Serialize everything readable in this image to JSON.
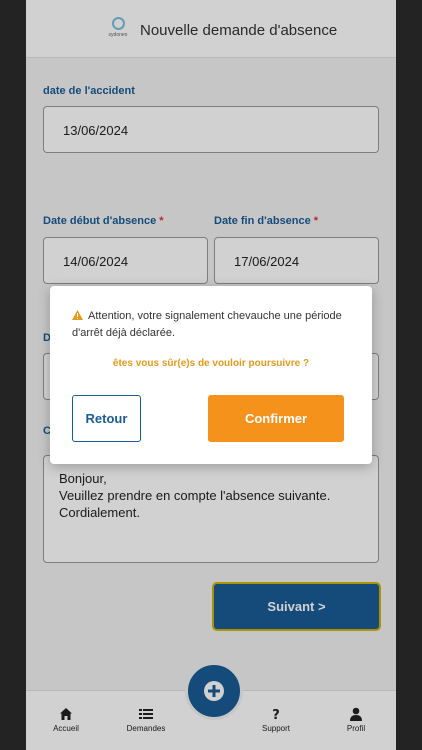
{
  "header": {
    "logo_text": "sydoneo",
    "title": "Nouvelle demande d'absence"
  },
  "form": {
    "accident_date": {
      "label": "date de l'accident",
      "value": "13/06/2024"
    },
    "start_date": {
      "label": "Date début d'absence",
      "required_mark": "*",
      "value": "14/06/2024"
    },
    "end_date": {
      "label": "Date fin d'absence",
      "required_mark": "*",
      "value": "17/06/2024"
    },
    "hidden_label_initial_1": "D",
    "hidden_label_initial_2": "C",
    "comment_lines": [
      "Bonjour,",
      "Veuillez prendre en compte l'absence suivante.",
      "Cordialement."
    ],
    "next_label": "Suivant >"
  },
  "dialog": {
    "warning": "Attention, votre signalement chevauche une période d'arrêt déjà déclarée.",
    "question": "êtes vous sûr(e)s de vouloir poursuivre ?",
    "back_label": "Retour",
    "confirm_label": "Confirmer",
    "warning_color": "#e59a1a"
  },
  "nav": {
    "items": [
      {
        "label": "Accueil",
        "icon": "home-icon"
      },
      {
        "label": "Demandes",
        "icon": "list-icon"
      },
      {
        "label": "Support",
        "icon": "question-icon"
      },
      {
        "label": "Profil",
        "icon": "user-icon"
      }
    ],
    "fab_icon": "plus-icon"
  },
  "colors": {
    "primary": "#1a5c95",
    "accent": "#f5921b",
    "next_border": "#d4b300"
  }
}
